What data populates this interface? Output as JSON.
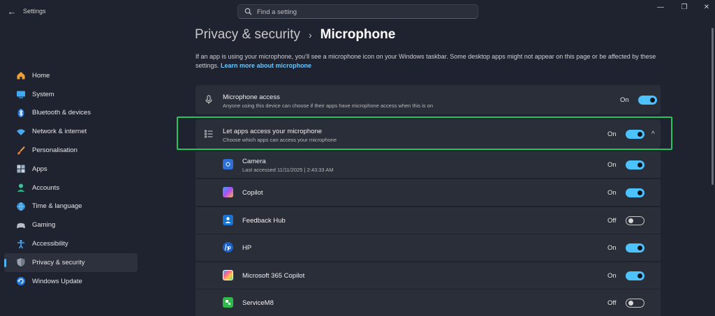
{
  "window": {
    "title": "Settings",
    "back": "←",
    "minimize": "—",
    "restore": "❐",
    "close": "✕"
  },
  "search": {
    "placeholder": "Find a setting"
  },
  "sidebar": {
    "items": [
      {
        "label": "Home",
        "icon": "home-icon"
      },
      {
        "label": "System",
        "icon": "system-icon"
      },
      {
        "label": "Bluetooth & devices",
        "icon": "bluetooth-icon"
      },
      {
        "label": "Network & internet",
        "icon": "wifi-icon"
      },
      {
        "label": "Personalisation",
        "icon": "brush-icon"
      },
      {
        "label": "Apps",
        "icon": "apps-icon"
      },
      {
        "label": "Accounts",
        "icon": "accounts-icon"
      },
      {
        "label": "Time & language",
        "icon": "globe-icon"
      },
      {
        "label": "Gaming",
        "icon": "gamepad-icon"
      },
      {
        "label": "Accessibility",
        "icon": "accessibility-icon"
      },
      {
        "label": "Privacy & security",
        "icon": "shield-icon",
        "active": true
      },
      {
        "label": "Windows Update",
        "icon": "update-icon"
      }
    ]
  },
  "header": {
    "parent": "Privacy & security",
    "separator": "›",
    "current": "Microphone"
  },
  "description": {
    "text": "If an app is using your microphone, you’ll see a microphone icon on your Windows taskbar. Some desktop apps might not appear on this page or be affected by these settings.",
    "link": "Learn more about microphone"
  },
  "microphone_access": {
    "title": "Microphone access",
    "subtitle": "Anyone using this device can choose if their apps have microphone access when this is on",
    "state": "On"
  },
  "let_apps": {
    "title": "Let apps access your microphone",
    "subtitle": "Choose which apps can access your microphone",
    "state": "On",
    "chevron": "^"
  },
  "apps": [
    {
      "name": "Camera",
      "sub": "Last accessed 11/11/2025  |  2:43:33 AM",
      "state": "On",
      "icon": "camera-app-icon",
      "color": "#2f6fd6"
    },
    {
      "name": "Copilot",
      "sub": "",
      "state": "On",
      "icon": "copilot-app-icon",
      "color": "#7b5cf0"
    },
    {
      "name": "Feedback Hub",
      "sub": "",
      "state": "Off",
      "icon": "feedback-hub-icon",
      "color": "#1b73d1"
    },
    {
      "name": "HP",
      "sub": "",
      "state": "On",
      "icon": "hp-app-icon",
      "color": "#1a5fc9"
    },
    {
      "name": "Microsoft 365 Copilot",
      "sub": "",
      "state": "On",
      "icon": "m365-copilot-icon",
      "color": "#d94f7a"
    },
    {
      "name": "ServiceM8",
      "sub": "",
      "state": "Off",
      "icon": "servicem8-icon",
      "color": "#2fb94a"
    }
  ],
  "colors": {
    "accent": "#4cc2ff",
    "highlight": "#22c55e",
    "background": "#1f2330",
    "card": "#2a2e39"
  }
}
